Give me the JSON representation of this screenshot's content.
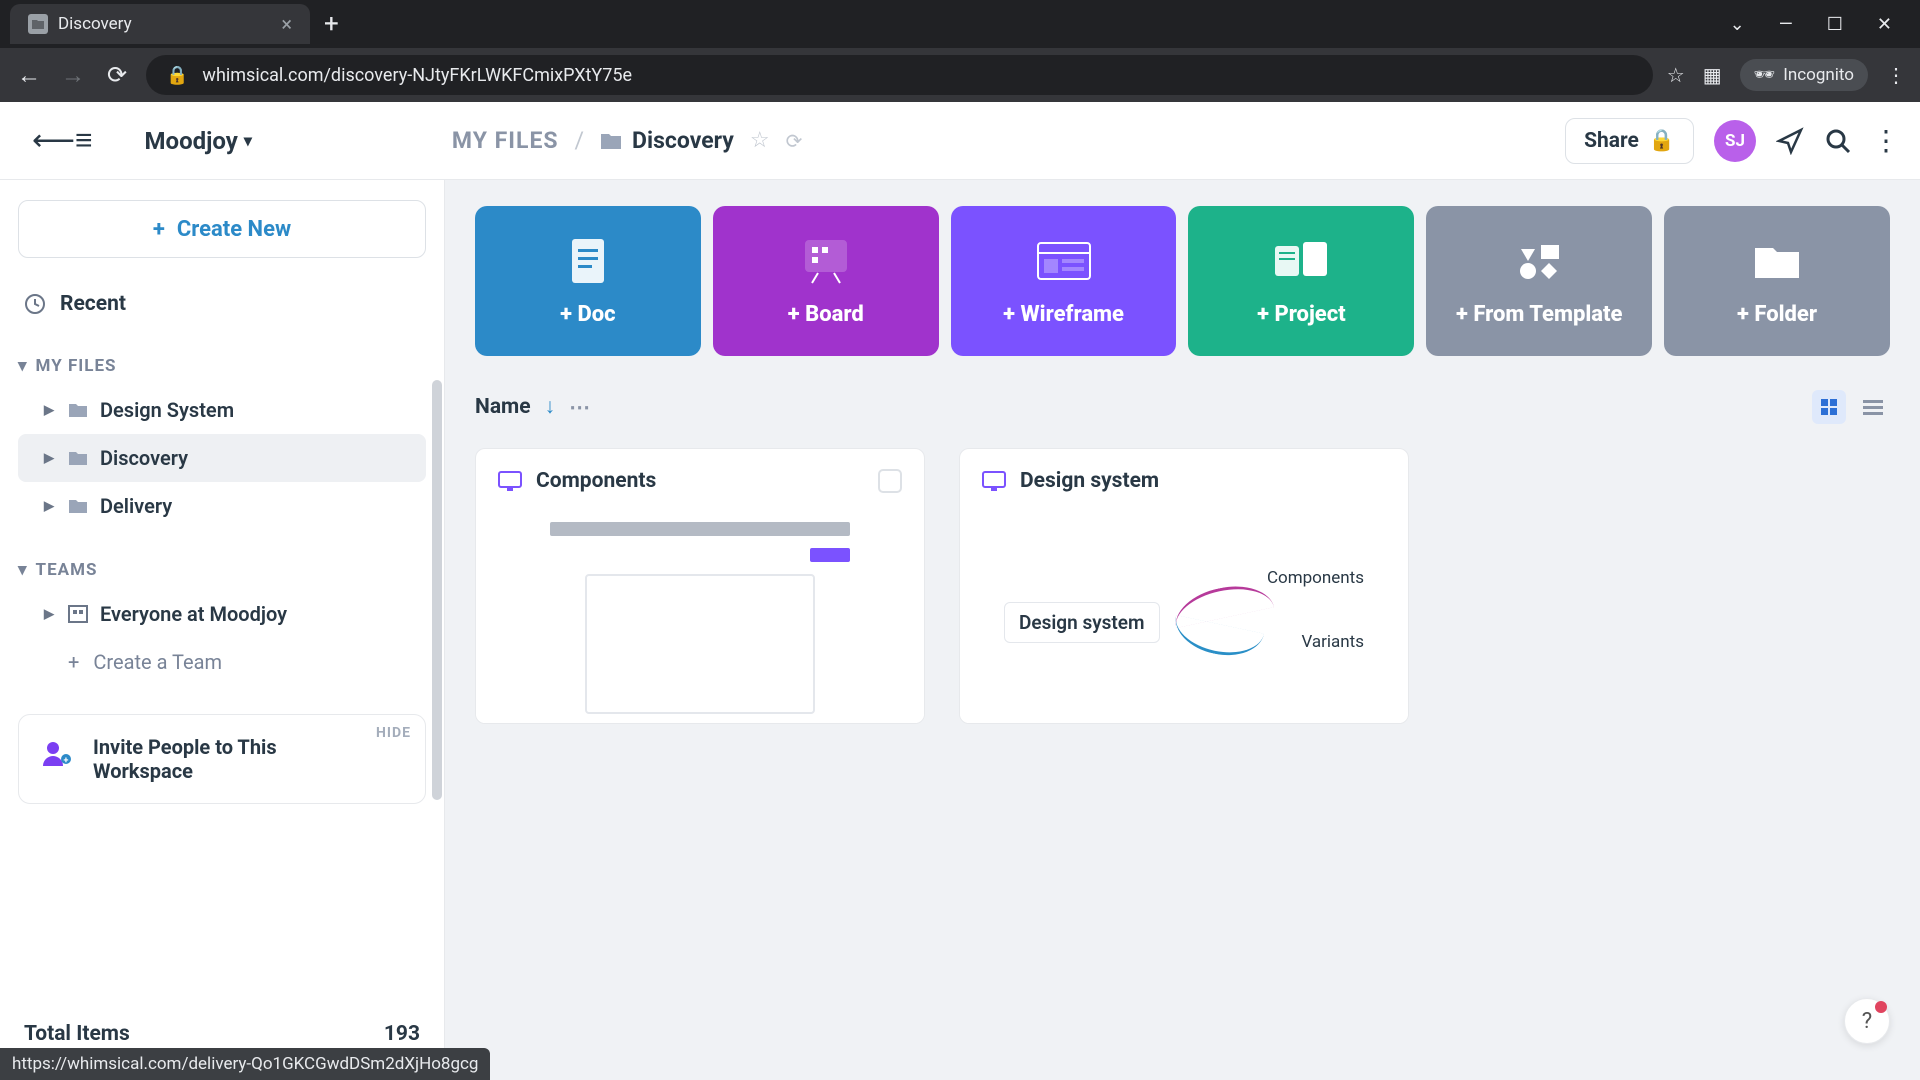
{
  "browser": {
    "tab_title": "Discovery",
    "url_display": "whimsical.com/discovery-NJtyFKrLWKFCmixPXtY75e",
    "incognito_label": "Incognito"
  },
  "header": {
    "workspace": "Moodjoy",
    "breadcrumb_root": "MY FILES",
    "breadcrumb_current": "Discovery",
    "share_label": "Share",
    "avatar_initials": "SJ"
  },
  "sidebar": {
    "create_label": "Create New",
    "recent_label": "Recent",
    "files_section": "MY FILES",
    "folders": [
      {
        "label": "Design System",
        "active": false
      },
      {
        "label": "Discovery",
        "active": true
      },
      {
        "label": "Delivery",
        "active": false
      }
    ],
    "teams_section": "TEAMS",
    "team_item": "Everyone at Moodjoy",
    "create_team": "Create a Team",
    "invite_title": "Invite People to This Workspace",
    "hide_label": "HIDE",
    "totals_label": "Total Items",
    "totals_value": "193"
  },
  "tiles": {
    "doc": "+ Doc",
    "board": "+ Board",
    "wireframe": "+ Wireframe",
    "project": "+ Project",
    "template": "+ From Template",
    "folder": "+ Folder"
  },
  "sort": {
    "label": "Name"
  },
  "cards": [
    {
      "title": "Components",
      "type": "wireframe"
    },
    {
      "title": "Design system",
      "type": "mindmap",
      "root": "Design system",
      "leaf1": "Components",
      "leaf2": "Variants"
    }
  ],
  "status_url": "https://whimsical.com/delivery-Qo1GKCGwdDSm2dXjHo8gcg"
}
